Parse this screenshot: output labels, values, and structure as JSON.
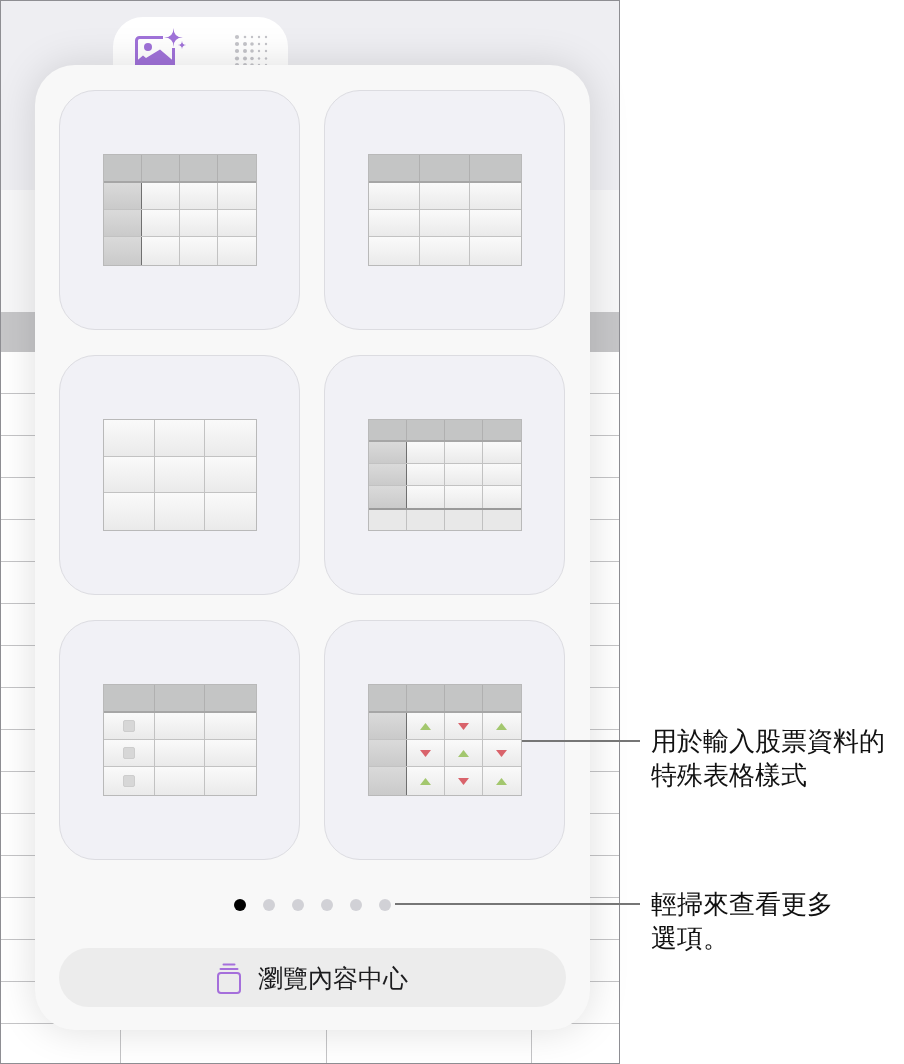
{
  "tabs": [
    {
      "kind": "media",
      "selected": true
    },
    {
      "kind": "grid",
      "selected": false
    }
  ],
  "table_styles": [
    {
      "kind": "header_row_column"
    },
    {
      "kind": "header_row"
    },
    {
      "kind": "plain"
    },
    {
      "kind": "header_row_column_footer"
    },
    {
      "kind": "checklist"
    },
    {
      "kind": "stock"
    }
  ],
  "page_dots": [
    {
      "selected": true
    },
    {
      "selected": false
    },
    {
      "selected": false
    },
    {
      "selected": false
    },
    {
      "selected": false
    },
    {
      "selected": false
    }
  ],
  "browse_button": {
    "label": "瀏覽內容中心"
  },
  "callouts": [
    {
      "kind": "table_style",
      "text": "用於輸入股票資料的特殊表格樣式"
    },
    {
      "kind": "page_dots",
      "text": "輕掃來查看更多選項。"
    }
  ]
}
